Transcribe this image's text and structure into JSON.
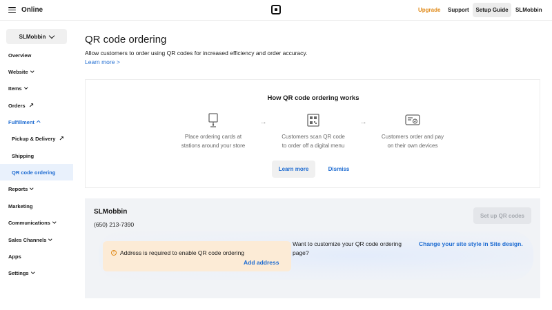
{
  "topbar": {
    "brand": "Online",
    "upgrade": "Upgrade",
    "support": "Support",
    "setup_guide": "Setup Guide",
    "account": "SLMobbin",
    "accent_color": "#e08a19"
  },
  "sidebar": {
    "store_name": "SLMobbin",
    "items": [
      {
        "label": "Overview"
      },
      {
        "label": "Website"
      },
      {
        "label": "Items"
      },
      {
        "label": "Orders"
      },
      {
        "label": "Fulfillment"
      },
      {
        "label": "Pickup & Delivery"
      },
      {
        "label": "Shipping"
      },
      {
        "label": "QR code ordering"
      },
      {
        "label": "Reports"
      },
      {
        "label": "Marketing"
      },
      {
        "label": "Communications"
      },
      {
        "label": "Sales Channels"
      },
      {
        "label": "Apps"
      },
      {
        "label": "Settings"
      }
    ]
  },
  "main": {
    "title": "QR code ordering",
    "description": "Allow customers to order using QR codes for increased efficiency and order accuracy.",
    "learn_more": "Learn more >",
    "how": {
      "title": "How QR code ordering works",
      "steps": [
        {
          "icon": "ordering-card-icon",
          "line1": "Place ordering cards at",
          "line2": "stations around your store"
        },
        {
          "icon": "qr-code-icon",
          "line1": "Customers scan QR code",
          "line2": "to order off a digital menu"
        },
        {
          "icon": "device-payment-icon",
          "line1": "Customers order and pay",
          "line2": "on their own devices"
        }
      ],
      "learn_more_button": "Learn more",
      "dismiss_button": "Dismiss"
    },
    "store": {
      "name": "SLMobbin",
      "phone": "(650) 213-7390",
      "setup_button": "Set up QR codes",
      "alert_text": "Address is required to enable QR code ordering",
      "alert_link": "Add address",
      "customize_text": "Want to customize your QR code ordering page?",
      "customize_link": "Change your site style in Site design."
    }
  },
  "colors": {
    "link_blue": "#1d6bd1",
    "active_nav_bg": "#e9f1fc",
    "alert_bg": "#fcebd6"
  }
}
